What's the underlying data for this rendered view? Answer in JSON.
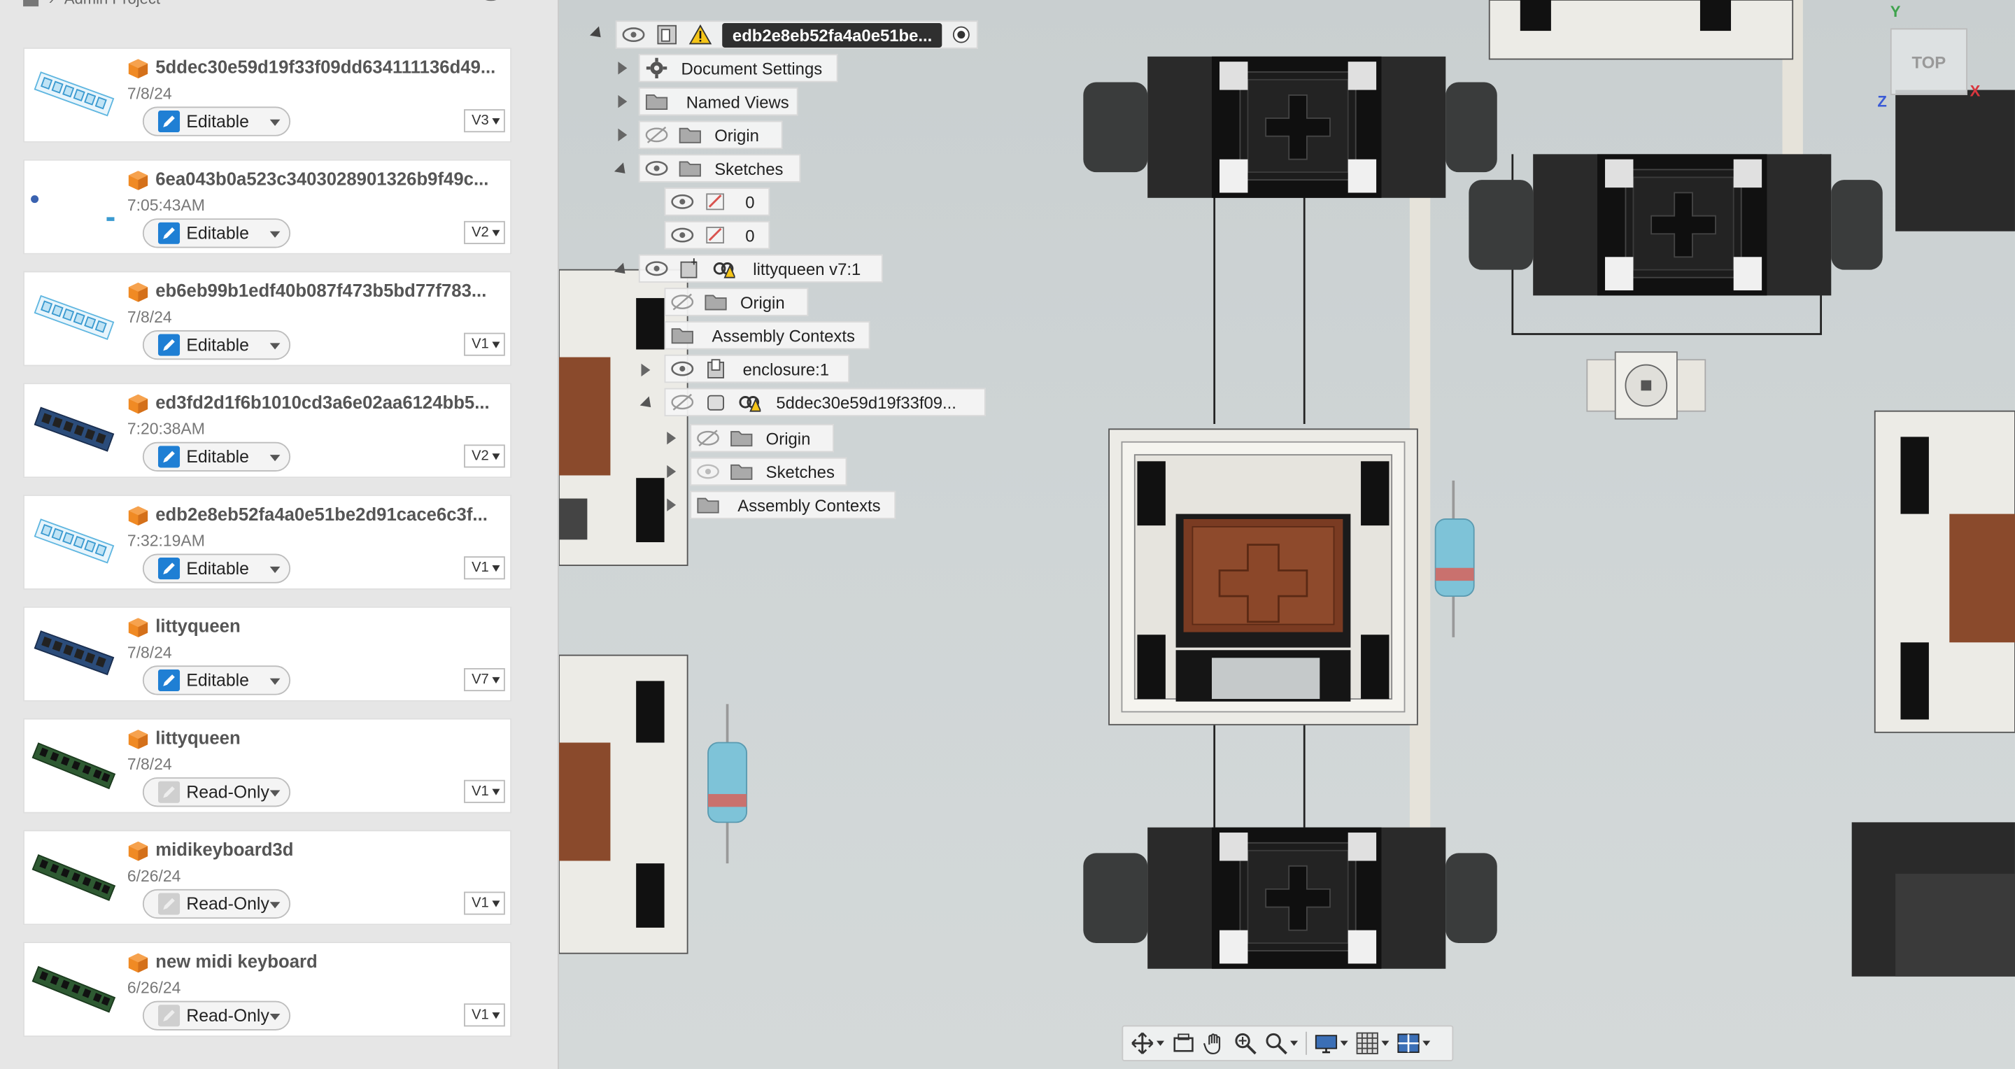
{
  "panel": {
    "project": "Admin Project",
    "files": [
      {
        "name": "5ddec30e59d19f33f09dd634111136d49...",
        "date": "7/8/24",
        "status": "Editable",
        "version": "V3",
        "thumb": "light-blue-board"
      },
      {
        "name": "6ea043b0a523c3403028901326b9f49c...",
        "date": "7:05:43AM",
        "status": "Editable",
        "version": "V2",
        "thumb": "small-parts"
      },
      {
        "name": "eb6eb99b1edf40b087f473b5bd77f783...",
        "date": "7/8/24",
        "status": "Editable",
        "version": "V1",
        "thumb": "light-blue-board"
      },
      {
        "name": "ed3fd2d1f6b1010cd3a6e02aa6124bb5...",
        "date": "7:20:38AM",
        "status": "Editable",
        "version": "V2",
        "thumb": "dark-blue-board"
      },
      {
        "name": "edb2e8eb52fa4a0e51be2d91cace6c3f...",
        "date": "7:32:19AM",
        "status": "Editable",
        "version": "V1",
        "thumb": "light-blue-board"
      },
      {
        "name": "littyqueen",
        "date": "7/8/24",
        "status": "Editable",
        "version": "V7",
        "thumb": "dark-blue-board"
      },
      {
        "name": "littyqueen",
        "date": "7/8/24",
        "status": "Read-Only",
        "version": "V1",
        "thumb": "green-board"
      },
      {
        "name": "midikeyboard3d",
        "date": "6/26/24",
        "status": "Read-Only",
        "version": "V1",
        "thumb": "green-board"
      },
      {
        "name": "new midi keyboard",
        "date": "6/26/24",
        "status": "Read-Only",
        "version": "V1",
        "thumb": "green-board"
      }
    ]
  },
  "browser": {
    "root": "edb2e8eb52fa4a0e51be...",
    "document_settings": "Document Settings",
    "named_views": "Named Views",
    "origin": "Origin",
    "sketches": "Sketches",
    "sketch_a": "0",
    "sketch_b": "0",
    "component": "littyqueen v7:1",
    "comp_origin": "Origin",
    "comp_assembly": "Assembly Contexts",
    "enclosure": "enclosure:1",
    "sub": "5ddec30e59d19f33f09...",
    "sub_origin": "Origin",
    "sub_sketches": "Sketches",
    "sub_assembly": "Assembly Contexts"
  },
  "viewcube": {
    "face": "TOP",
    "axis_y": "Y",
    "axis_z": "Z",
    "axis_x": "X"
  },
  "colors": {
    "accent_editable": "#1f7fd4",
    "cube_orange": "#f08a24",
    "keycap_brown": "#8a4a2c",
    "switch_black": "#1e1e1e"
  }
}
